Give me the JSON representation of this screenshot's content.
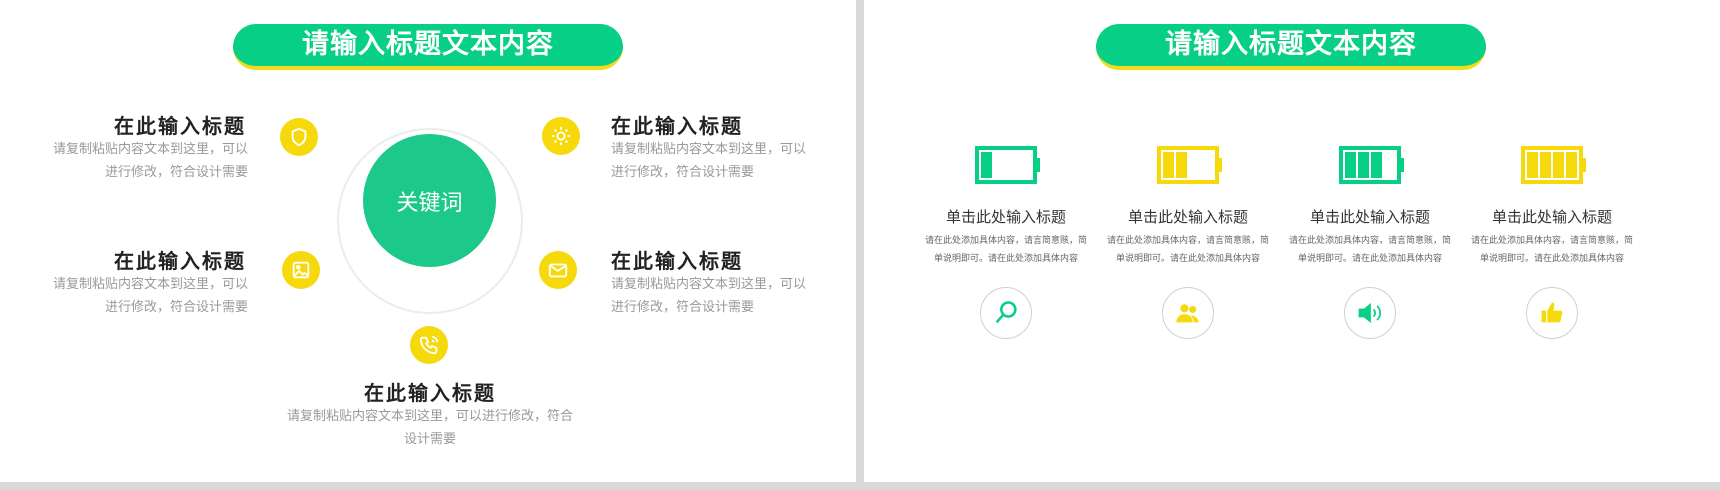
{
  "left_slide": {
    "title": "请输入标题文本内容",
    "center_label": "关键词",
    "items": [
      {
        "title": "在此输入标题",
        "text": "请复制粘贴内容文本到这里，可以进行修改，符合设计需要",
        "icon": "shield-icon"
      },
      {
        "title": "在此输入标题",
        "text": "请复制粘贴内容文本到这里，可以进行修改，符合设计需要",
        "icon": "image-icon"
      },
      {
        "title": "在此输入标题",
        "text": "请复制粘贴内容文本到这里，可以进行修改，符合设计需要",
        "icon": "sun-icon"
      },
      {
        "title": "在此输入标题",
        "text": "请复制粘贴内容文本到这里，可以进行修改，符合设计需要",
        "icon": "mail-icon"
      },
      {
        "title": "在此输入标题",
        "text": "请复制粘贴内容文本到这里，可以进行修改，符合设计需要",
        "icon": "phone-icon"
      }
    ]
  },
  "right_slide": {
    "title": "请输入标题文本内容",
    "columns": [
      {
        "title": "单击此处输入标题",
        "text": "请在此处添加具体内容，请言简意赅，简单说明即可。请在此处添加具体内容",
        "battery_color": "#08cf86",
        "battery_level": 0.25,
        "icon": "magnifier-icon",
        "icon_color": "#08cf86"
      },
      {
        "title": "单击此处输入标题",
        "text": "请在此处添加具体内容，请言简意赅，简单说明即可。请在此处添加具体内容",
        "battery_color": "#f5d90a",
        "battery_level": 0.5,
        "icon": "users-icon",
        "icon_color": "#f5d90a"
      },
      {
        "title": "单击此处输入标题",
        "text": "请在此处添加具体内容，请言简意赅，简单说明即可。请在此处添加具体内容",
        "battery_color": "#08cf86",
        "battery_level": 0.75,
        "icon": "speaker-icon",
        "icon_color": "#08cf86"
      },
      {
        "title": "单击此处输入标题",
        "text": "请在此处添加具体内容，请言简意赅，简单说明即可。请在此处添加具体内容",
        "battery_color": "#f5d90a",
        "battery_level": 1.0,
        "icon": "thumbs-up-icon",
        "icon_color": "#f5d90a"
      }
    ]
  },
  "colors": {
    "primary": "#08cf86",
    "accent": "#f5d90a"
  }
}
